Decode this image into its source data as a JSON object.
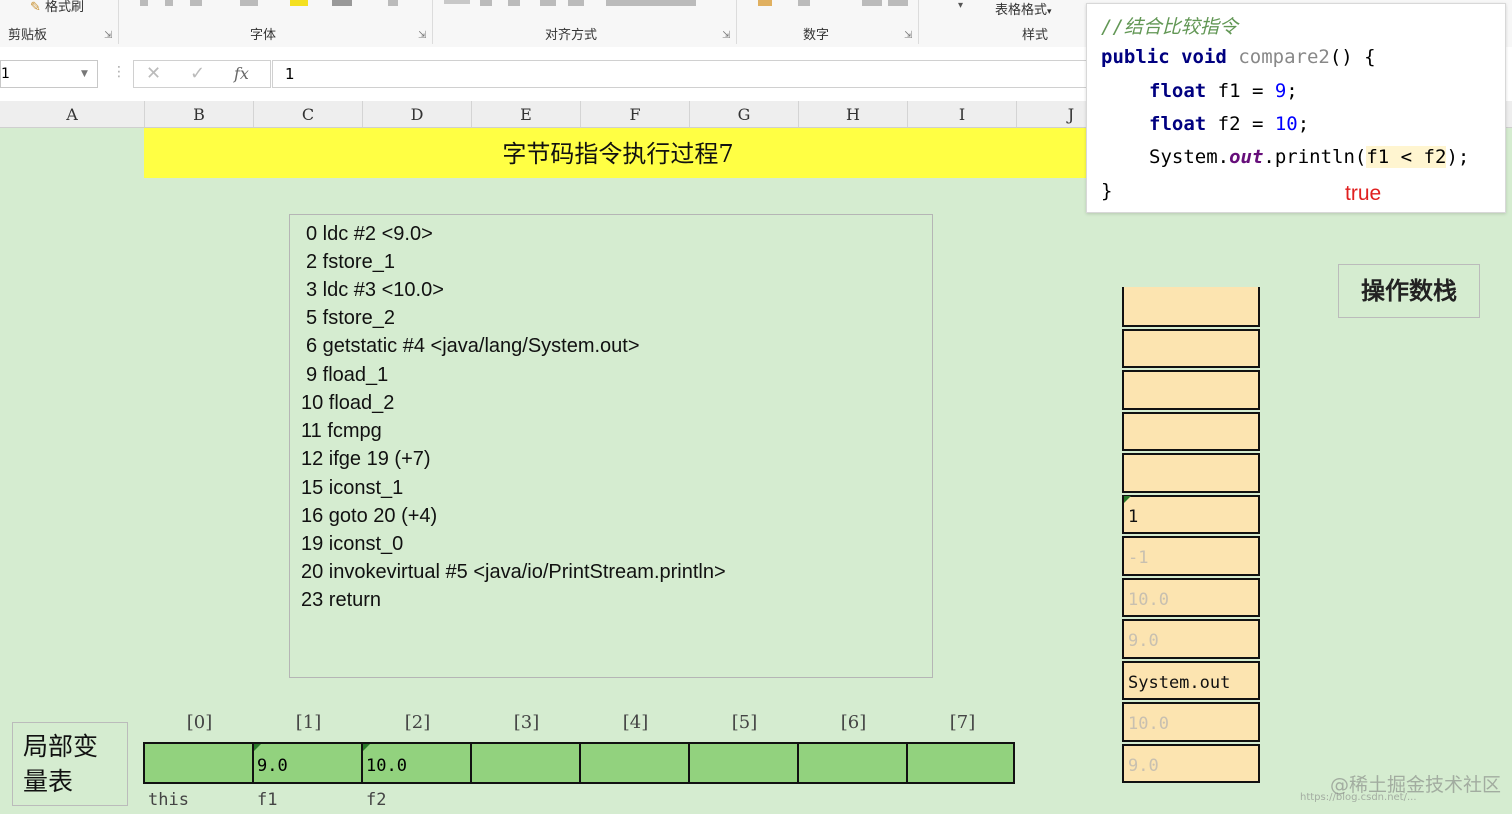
{
  "ribbon": {
    "format_painter": "格式刷",
    "groups": [
      "剪贴板",
      "字体",
      "对齐方式",
      "数字",
      "样式"
    ],
    "table_format": "表格格式"
  },
  "formula_bar": {
    "name_box": "1",
    "formula": "1",
    "fx": "fx"
  },
  "columns": [
    "A",
    "B",
    "C",
    "D",
    "E",
    "F",
    "G",
    "H",
    "I",
    "J"
  ],
  "title": "字节码指令执行过程7",
  "bytecode": [
    "0 ldc #2 <9.0>",
    "2 fstore_1",
    "3 ldc #3 <10.0>",
    "5 fstore_2",
    "6 getstatic #4 <java/lang/System.out>",
    "9 fload_1",
    "10 fload_2",
    "11 fcmpg",
    "12 ifge 19 (+7)",
    "15 iconst_1",
    "16 goto 20 (+4)",
    "19 iconst_0",
    "20 invokevirtual #5 <java/io/PrintStream.println>",
    "23 return"
  ],
  "java": {
    "comment": "//结合比较指令",
    "kw_public": "public",
    "kw_void": "void",
    "method": "compare2",
    "sig_rest": "() {",
    "kw_float": "float",
    "f1_decl": " f1 = ",
    "f1_val": "9",
    "f2_decl": " f2 = ",
    "f2_val": "10",
    "semi": ";",
    "sys": "System.",
    "out": "out",
    "println": ".println(",
    "expr": "f1 < f2",
    "close_call": ");",
    "close_brace": "}",
    "result": "true"
  },
  "operand_stack": {
    "label": "操作数栈",
    "cells": [
      "",
      "",
      "",
      "",
      "",
      "1",
      "-1",
      "10.0",
      "9.0",
      "System.out",
      "10.0",
      "9.0"
    ],
    "faded": [
      false,
      false,
      false,
      false,
      false,
      false,
      true,
      true,
      true,
      false,
      true,
      true
    ]
  },
  "local_vars": {
    "label_line1": "局部变",
    "label_line2": "量表",
    "indexes": [
      "[0]",
      "[1]",
      "[2]",
      "[3]",
      "[4]",
      "[5]",
      "[6]",
      "[7]"
    ],
    "values": [
      "",
      "9.0",
      "10.0",
      "",
      "",
      "",
      "",
      ""
    ],
    "names": [
      "this",
      "f1",
      "f2"
    ]
  },
  "watermark": "@稀土掘金技术社区",
  "watermark_url": "https://blog.csdn.net/...",
  "colors": {
    "sheet_bg": "#d5ecd0",
    "title_band": "#ffff44",
    "stack_cell": "#fce4b0",
    "lvt_cell": "#92d27e",
    "result_red": "#e02020"
  }
}
